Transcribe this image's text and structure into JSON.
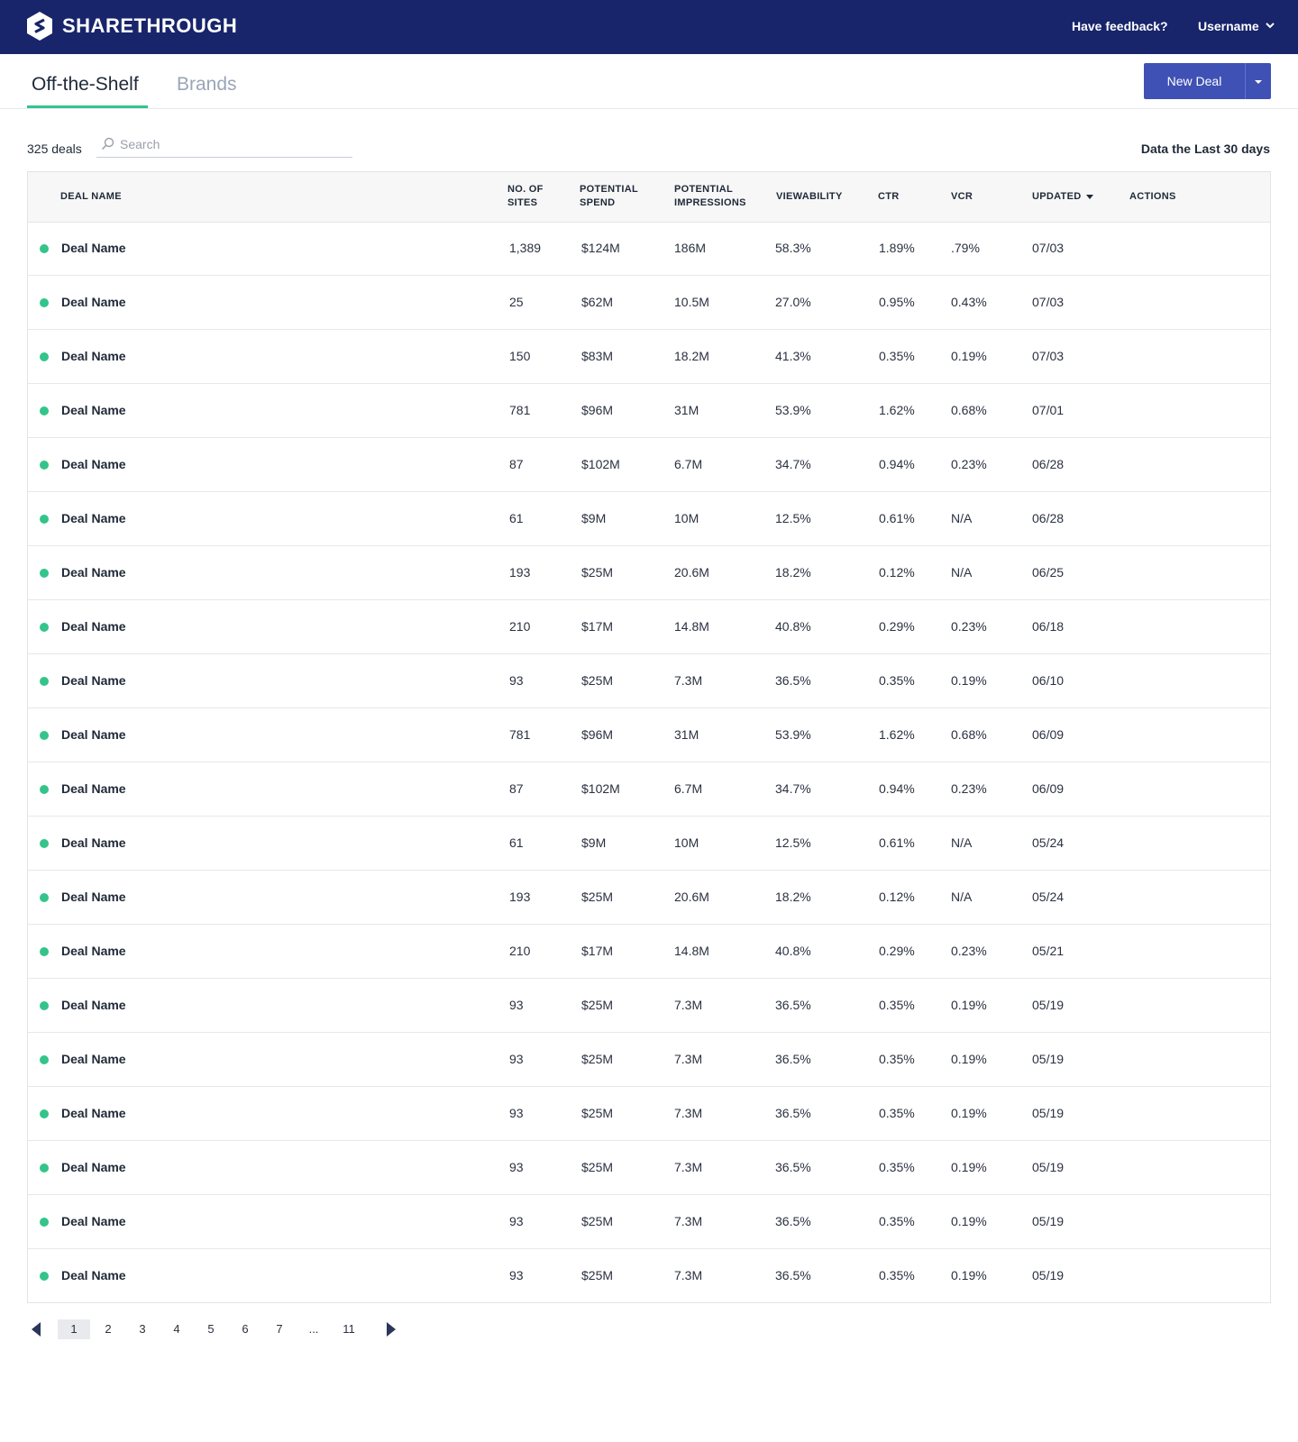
{
  "brand": {
    "name": "SHARETHROUGH",
    "logo_icon": "hexagon-s-logo"
  },
  "header": {
    "feedback": "Have feedback?",
    "username": "Username"
  },
  "tabs": [
    {
      "label": "Off-the-Shelf",
      "active": true
    },
    {
      "label": "Brands",
      "active": false
    }
  ],
  "new_deal": {
    "label": "New Deal"
  },
  "toolbar": {
    "count": "325 deals",
    "search_placeholder": "Search",
    "data_range": "Data the Last 30 days"
  },
  "table": {
    "columns": [
      "Deal Name",
      "No. of Sites",
      "Potential Spend",
      "Potential Impressions",
      "Viewability",
      "CTR",
      "VCR",
      "Updated",
      "Actions"
    ],
    "sorted_by": "Updated",
    "rows": [
      [
        "Deal Name",
        "1,389",
        "$124M",
        "186M",
        "58.3%",
        "1.89%",
        ".79%",
        "07/03"
      ],
      [
        "Deal Name",
        "25",
        "$62M",
        "10.5M",
        "27.0%",
        "0.95%",
        "0.43%",
        "07/03"
      ],
      [
        "Deal Name",
        "150",
        "$83M",
        "18.2M",
        "41.3%",
        "0.35%",
        "0.19%",
        "07/03"
      ],
      [
        "Deal Name",
        "781",
        "$96M",
        "31M",
        "53.9%",
        "1.62%",
        "0.68%",
        "07/01"
      ],
      [
        "Deal Name",
        "87",
        "$102M",
        "6.7M",
        "34.7%",
        "0.94%",
        "0.23%",
        "06/28"
      ],
      [
        "Deal Name",
        "61",
        "$9M",
        "10M",
        "12.5%",
        "0.61%",
        "N/A",
        "06/28"
      ],
      [
        "Deal Name",
        "193",
        "$25M",
        "20.6M",
        "18.2%",
        "0.12%",
        "N/A",
        "06/25"
      ],
      [
        "Deal Name",
        "210",
        "$17M",
        "14.8M",
        "40.8%",
        "0.29%",
        "0.23%",
        "06/18"
      ],
      [
        "Deal Name",
        "93",
        "$25M",
        "7.3M",
        "36.5%",
        "0.35%",
        "0.19%",
        "06/10"
      ],
      [
        "Deal Name",
        "781",
        "$96M",
        "31M",
        "53.9%",
        "1.62%",
        "0.68%",
        "06/09"
      ],
      [
        "Deal Name",
        "87",
        "$102M",
        "6.7M",
        "34.7%",
        "0.94%",
        "0.23%",
        "06/09"
      ],
      [
        "Deal Name",
        "61",
        "$9M",
        "10M",
        "12.5%",
        "0.61%",
        "N/A",
        "05/24"
      ],
      [
        "Deal Name",
        "193",
        "$25M",
        "20.6M",
        "18.2%",
        "0.12%",
        "N/A",
        "05/24"
      ],
      [
        "Deal Name",
        "210",
        "$17M",
        "14.8M",
        "40.8%",
        "0.29%",
        "0.23%",
        "05/21"
      ],
      [
        "Deal Name",
        "93",
        "$25M",
        "7.3M",
        "36.5%",
        "0.35%",
        "0.19%",
        "05/19"
      ],
      [
        "Deal Name",
        "93",
        "$25M",
        "7.3M",
        "36.5%",
        "0.35%",
        "0.19%",
        "05/19"
      ],
      [
        "Deal Name",
        "93",
        "$25M",
        "7.3M",
        "36.5%",
        "0.35%",
        "0.19%",
        "05/19"
      ],
      [
        "Deal Name",
        "93",
        "$25M",
        "7.3M",
        "36.5%",
        "0.35%",
        "0.19%",
        "05/19"
      ],
      [
        "Deal Name",
        "93",
        "$25M",
        "7.3M",
        "36.5%",
        "0.35%",
        "0.19%",
        "05/19"
      ],
      [
        "Deal Name",
        "93",
        "$25M",
        "7.3M",
        "36.5%",
        "0.35%",
        "0.19%",
        "05/19"
      ]
    ],
    "status_color": "#34c48b"
  },
  "pagination": {
    "pages": [
      "1",
      "2",
      "3",
      "4",
      "5",
      "6",
      "7",
      "...",
      "11"
    ],
    "current": "1"
  },
  "colors": {
    "header_bg": "#18256b",
    "accent": "#34c48b",
    "button": "#3f51b5"
  }
}
